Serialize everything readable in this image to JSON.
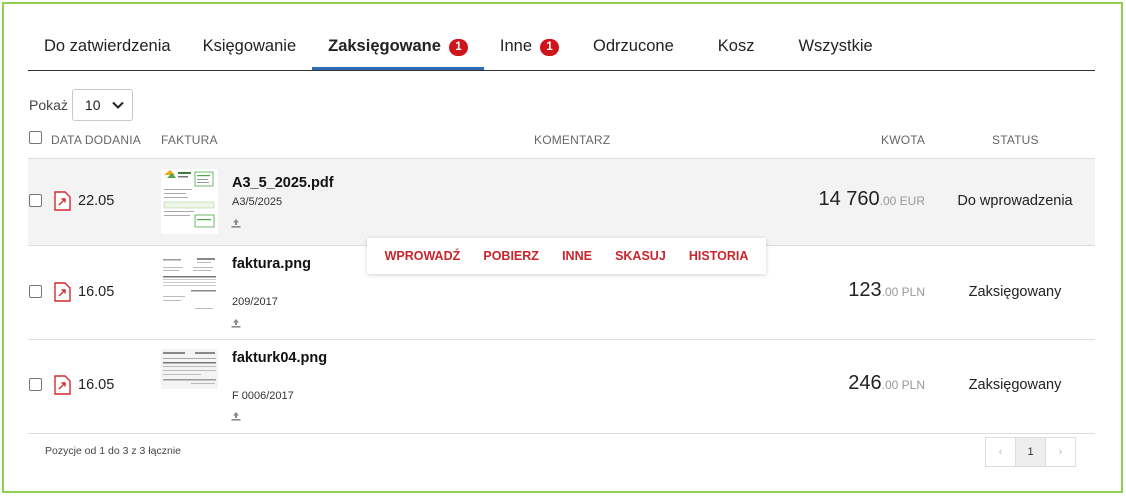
{
  "tabs": [
    {
      "label": "Do zatwierdzenia",
      "badge": ""
    },
    {
      "label": "Księgowanie",
      "badge": ""
    },
    {
      "label": "Zaksięgowane",
      "badge": "1"
    },
    {
      "label": "Inne",
      "badge": "1"
    },
    {
      "label": "Odrzucone",
      "badge": ""
    },
    {
      "label": "Kosz",
      "badge": ""
    },
    {
      "label": "Wszystkie",
      "badge": ""
    }
  ],
  "active_tab": "Zaksięgowane",
  "show": {
    "label": "Pokaż",
    "value": "10"
  },
  "columns": {
    "date": "DATA DODANIA",
    "invoice": "FAKTURA",
    "comment": "KOMENTARZ",
    "amount": "KWOTA",
    "status": "STATUS"
  },
  "rows": [
    {
      "date": "22.05",
      "file": "A3_5_2025.pdf",
      "number": "A3/5/2025",
      "amount_main": "14 760",
      "amount_dec": ".00 EUR",
      "status": "Do wprowadzenia"
    },
    {
      "date": "16.05",
      "file": "faktura.png",
      "number": "209/2017",
      "amount_main": "123",
      "amount_dec": ".00 PLN",
      "status": "Zaksięgowany"
    },
    {
      "date": "16.05",
      "file": "fakturk04.png",
      "number": "F 0006/2017",
      "amount_main": "246",
      "amount_dec": ".00 PLN",
      "status": "Zaksięgowany"
    }
  ],
  "actions": [
    "WPROWADŹ",
    "POBIERZ",
    "INNE",
    "SKASUJ",
    "HISTORIA"
  ],
  "footer": {
    "summary": "Pozycje od 1 do 3 z 3 łącznie"
  },
  "pagination": {
    "prev": "‹",
    "current": "1",
    "next": "›"
  },
  "colors": {
    "accent": "#2e6db4",
    "badge": "#d0141b",
    "action": "#c8262c",
    "frame": "#8fd14f"
  }
}
